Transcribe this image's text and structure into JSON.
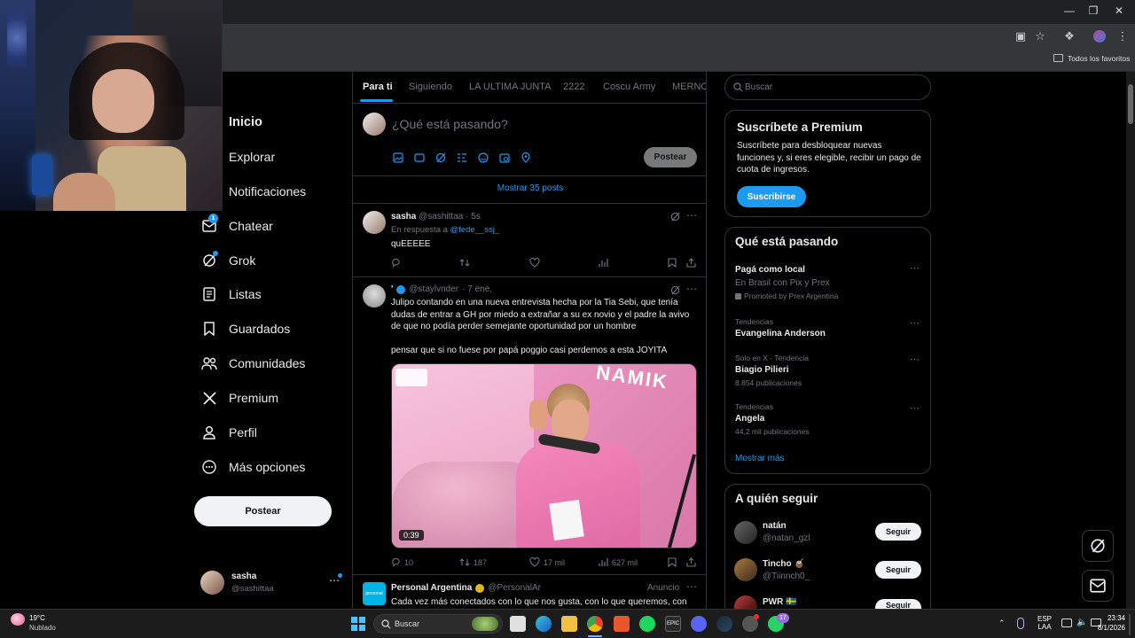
{
  "browser": {
    "bookmarks_label": "Todos los favoritos"
  },
  "nav": {
    "items": [
      {
        "label": "Inicio",
        "icon": "home-icon"
      },
      {
        "label": "Explorar",
        "icon": "search-icon"
      },
      {
        "label": "Notificaciones",
        "icon": "bell-icon"
      },
      {
        "label": "Chatear",
        "icon": "mail-icon",
        "badge": "1"
      },
      {
        "label": "Grok",
        "icon": "grok-icon"
      },
      {
        "label": "Listas",
        "icon": "list-icon"
      },
      {
        "label": "Guardados",
        "icon": "bookmark-icon"
      },
      {
        "label": "Comunidades",
        "icon": "people-icon"
      },
      {
        "label": "Premium",
        "icon": "x-logo-icon"
      },
      {
        "label": "Perfil",
        "icon": "person-icon"
      },
      {
        "label": "Más opciones",
        "icon": "more-circle-icon"
      }
    ],
    "post_button": "Postear",
    "account": {
      "name": "sasha",
      "handle": "@sashittaa"
    }
  },
  "tabs": [
    "Para ti",
    "Siguiendo",
    "LA ULTIMA JUNTA",
    "2222",
    "Coscu Army",
    "MERNOS"
  ],
  "composer": {
    "placeholder": "¿Qué está pasando?",
    "post_button": "Postear"
  },
  "show_more": "Mostrar 35 posts",
  "tweets": [
    {
      "name": "sasha",
      "handle": "@sashittaa",
      "time": "· 5s",
      "reply_prefix": "En respuesta a",
      "reply_to": "@fede__ssj_",
      "text": "quEEEEE"
    },
    {
      "name": "'",
      "handle": "@staylvnder",
      "time": "· 7 ene.",
      "text": "Julipo contando en una nueva entrevista hecha por la Tia Sebi, que tenía dudas de entrar a GH por miedo a extrañar a su ex novio y el padre la avivo de que no podía perder semejante oportunidad por un hombre",
      "text2": "pensar que si no fuese por papá poggio casi perdemos a esta JOYITA",
      "video_duration": "0:39",
      "video_overlay": "NAMIK",
      "replies": "10",
      "reposts": "187",
      "likes": "17 mil",
      "views": "627 mil"
    },
    {
      "name": "Personal Argentina",
      "handle": "@PersonalAr",
      "tag": "Anuncio",
      "text": "Cada vez más conectados con lo que nos gusta, con lo que queremos, con"
    }
  ],
  "search": {
    "placeholder": "Buscar"
  },
  "premium": {
    "title": "Suscríbete a Premium",
    "text": "Suscríbete para desbloquear nuevas funciones y, si eres elegible, recibir un pago de cuota de ingresos.",
    "button": "Suscribirse"
  },
  "trends": {
    "title": "Qué está pasando",
    "items": [
      {
        "context": "",
        "title": "Pagá como local",
        "sub": "En Brasil con Pix y Prex",
        "promo": "Promoted by Prex Argentina"
      },
      {
        "context": "Tendencias",
        "title": "Evangelina Anderson",
        "sub": ""
      },
      {
        "context": "Solo en X · Tendencia",
        "title": "Biagio Pilieri",
        "sub": "8.854 publicaciones"
      },
      {
        "context": "Tendencias",
        "title": "Angela",
        "sub": "44,2 mil publicaciones"
      }
    ],
    "show_more": "Mostrar más"
  },
  "who_to_follow": {
    "title": "A quién seguir",
    "button": "Seguir",
    "users": [
      {
        "name": "natán",
        "handle": "@natan_gzl"
      },
      {
        "name": "Tincho 🧉",
        "handle": "@Tiinnch0_"
      },
      {
        "name": "PWR 🇸🇪",
        "handle": ""
      }
    ]
  },
  "taskbar": {
    "weather_temp": "19°C",
    "weather_desc": "Nublado",
    "search": "Buscar",
    "lang": "ESP",
    "lang2": "LAA",
    "time": "23:34",
    "date": "8/1/2026",
    "whatsapp_badge": "17"
  },
  "colors": {
    "accent": "#1d9bf0",
    "bg": "#000000",
    "border": "#2f3336",
    "muted": "#71767b"
  }
}
